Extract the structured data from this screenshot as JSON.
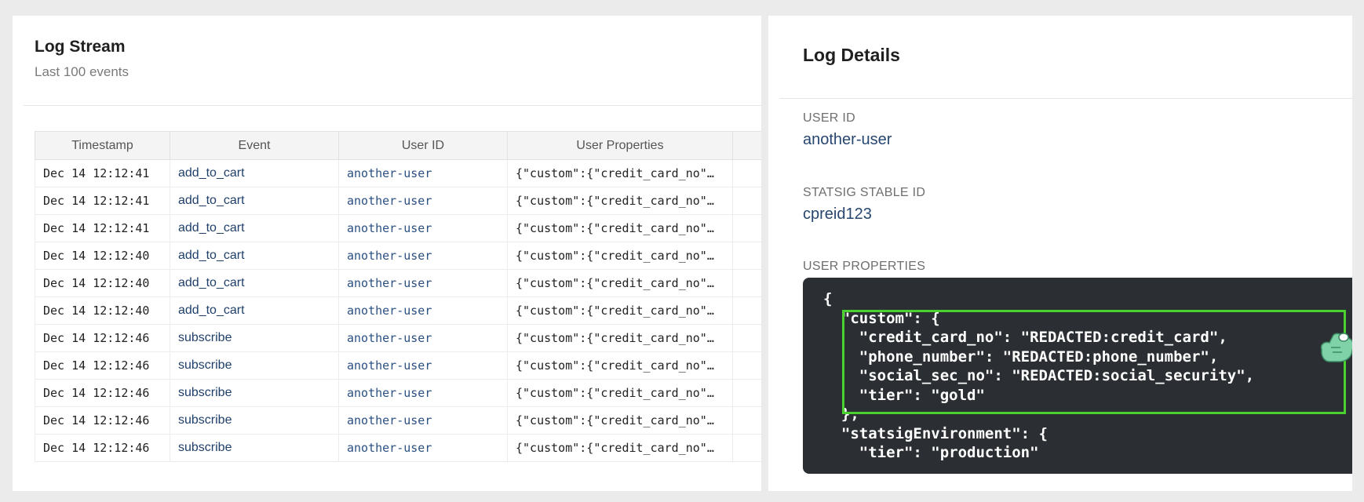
{
  "log_stream": {
    "title": "Log Stream",
    "subtitle": "Last 100 events",
    "columns": [
      "Timestamp",
      "Event",
      "User ID",
      "User Properties"
    ],
    "rows": [
      {
        "timestamp": "Dec 14 12:12:41",
        "event": "add_to_cart",
        "user_id": "another-user",
        "props": "{\"custom\":{\"credit_card_no\"…"
      },
      {
        "timestamp": "Dec 14 12:12:41",
        "event": "add_to_cart",
        "user_id": "another-user",
        "props": "{\"custom\":{\"credit_card_no\"…"
      },
      {
        "timestamp": "Dec 14 12:12:41",
        "event": "add_to_cart",
        "user_id": "another-user",
        "props": "{\"custom\":{\"credit_card_no\"…"
      },
      {
        "timestamp": "Dec 14 12:12:40",
        "event": "add_to_cart",
        "user_id": "another-user",
        "props": "{\"custom\":{\"credit_card_no\"…"
      },
      {
        "timestamp": "Dec 14 12:12:40",
        "event": "add_to_cart",
        "user_id": "another-user",
        "props": "{\"custom\":{\"credit_card_no\"…"
      },
      {
        "timestamp": "Dec 14 12:12:40",
        "event": "add_to_cart",
        "user_id": "another-user",
        "props": "{\"custom\":{\"credit_card_no\"…"
      },
      {
        "timestamp": "Dec 14 12:12:46",
        "event": "subscribe",
        "user_id": "another-user",
        "props": "{\"custom\":{\"credit_card_no\"…"
      },
      {
        "timestamp": "Dec 14 12:12:46",
        "event": "subscribe",
        "user_id": "another-user",
        "props": "{\"custom\":{\"credit_card_no\"…"
      },
      {
        "timestamp": "Dec 14 12:12:46",
        "event": "subscribe",
        "user_id": "another-user",
        "props": "{\"custom\":{\"credit_card_no\"…"
      },
      {
        "timestamp": "Dec 14 12:12:46",
        "event": "subscribe",
        "user_id": "another-user",
        "props": "{\"custom\":{\"credit_card_no\"…"
      },
      {
        "timestamp": "Dec 14 12:12:46",
        "event": "subscribe",
        "user_id": "another-user",
        "props": "{\"custom\":{\"credit_card_no\"…"
      }
    ]
  },
  "log_details": {
    "title": "Log Details",
    "user_id_label": "USER ID",
    "user_id_value": "another-user",
    "stable_id_label": "STATSIG STABLE ID",
    "stable_id_value": "cpreid123",
    "props_label": "USER PROPERTIES",
    "code_lines": [
      "{",
      "  \"custom\": {",
      "    \"credit_card_no\": \"REDACTED:credit_card\",",
      "    \"phone_number\": \"REDACTED:phone_number\",",
      "    \"social_sec_no\": \"REDACTED:social_security\",",
      "    \"tier\": \"gold\"",
      "  },",
      "  \"statsigEnvironment\": {",
      "    \"tier\": \"production\""
    ]
  },
  "colors": {
    "highlight": "#4bd12f",
    "code_bg": "#2b2f33",
    "link": "#27466f"
  },
  "icons": {
    "cursor": "hand-cursor-icon"
  }
}
